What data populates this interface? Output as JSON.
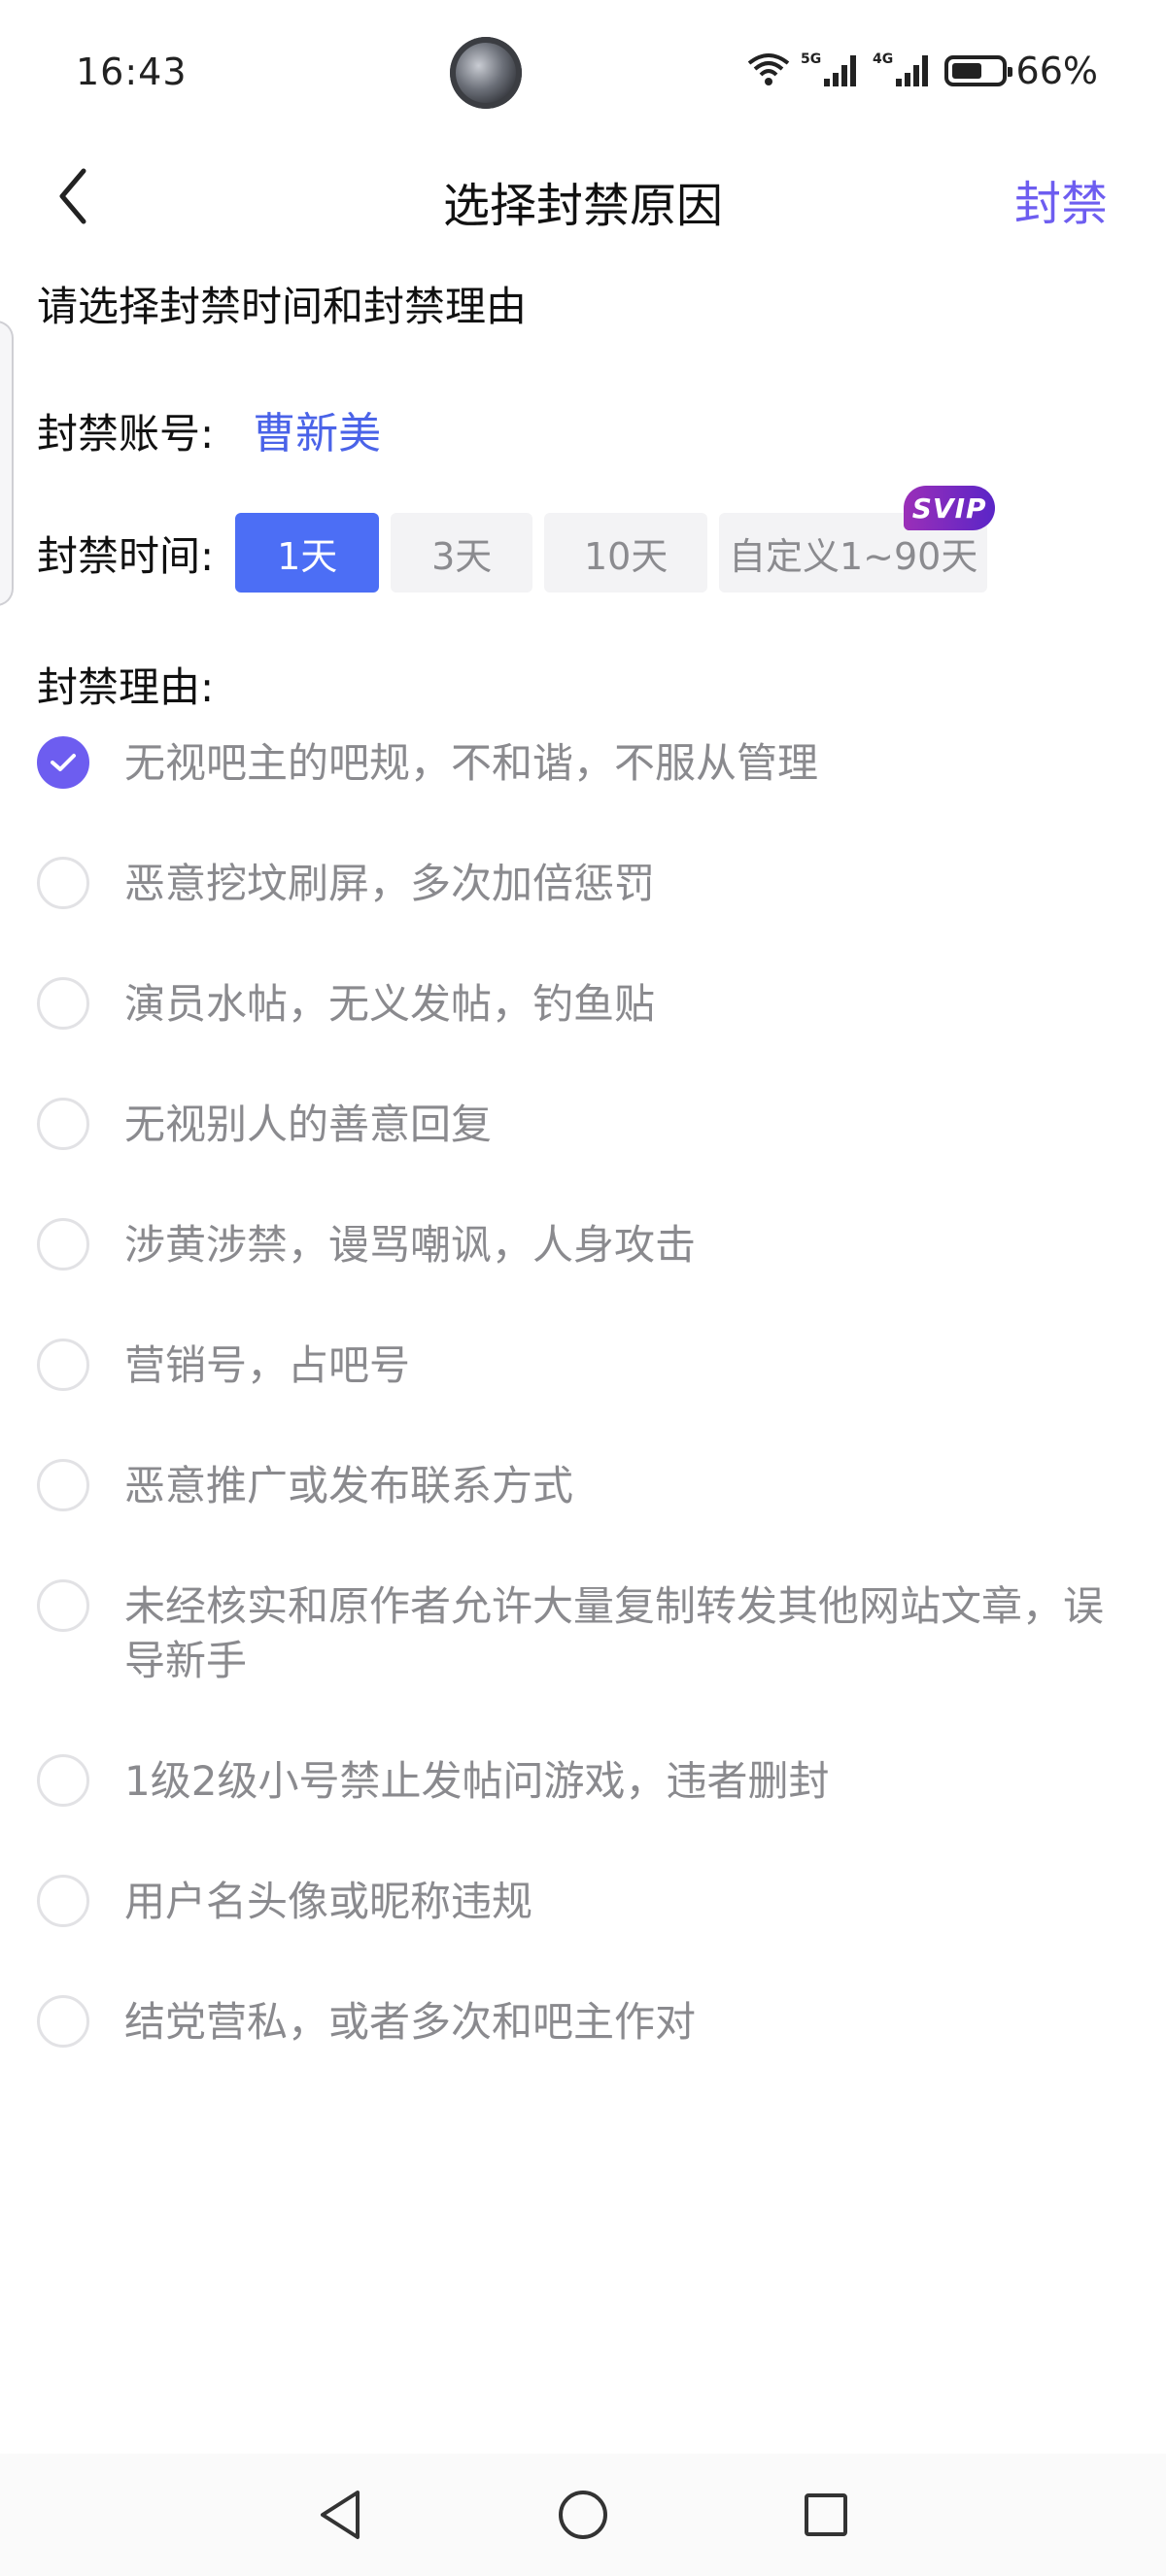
{
  "status_bar": {
    "time": "16:43",
    "battery_percent": "66%",
    "battery_level": 0.66,
    "network": [
      "wifi-icon",
      "5g-signal-icon",
      "4g-signal-icon",
      "battery-icon"
    ]
  },
  "header": {
    "title": "选择封禁原因",
    "action_label": "封禁",
    "back_icon": "chevron-left-icon"
  },
  "instruction": "请选择封禁时间和封禁理由",
  "account": {
    "label": "封禁账号:",
    "name": "曹新美"
  },
  "ban_time": {
    "label": "封禁时间:",
    "options": [
      "1天",
      "3天",
      "10天",
      "自定义1~90天"
    ],
    "selected": "1天",
    "badge": "SVIP"
  },
  "reason": {
    "label": "封禁理由:",
    "items": [
      "无视吧主的吧规，不和谐，不服从管理",
      "恶意挖坟刷屏，多次加倍惩罚",
      "演员水帖，无义发帖，钓鱼贴",
      "无视别人的善意回复",
      "涉黄涉禁，谩骂嘲讽，人身攻击",
      "营销号，占吧号",
      "恶意推广或发布联系方式",
      "未经核实和原作者允许大量复制转发其他网站文章，误导新手",
      "1级2级小号禁止发帖问游戏，违者删封",
      "用户名头像或昵称违规",
      "结党营私，或者多次和吧主作对"
    ],
    "selected_index": 0
  },
  "colors": {
    "accent": "#6d5df0",
    "primary_blue": "#4c6ef5",
    "link_blue": "#4a63e8",
    "muted_text": "#8a8a8e"
  },
  "nav_bar": [
    "back-triangle-icon",
    "home-circle-icon",
    "recents-square-icon"
  ]
}
